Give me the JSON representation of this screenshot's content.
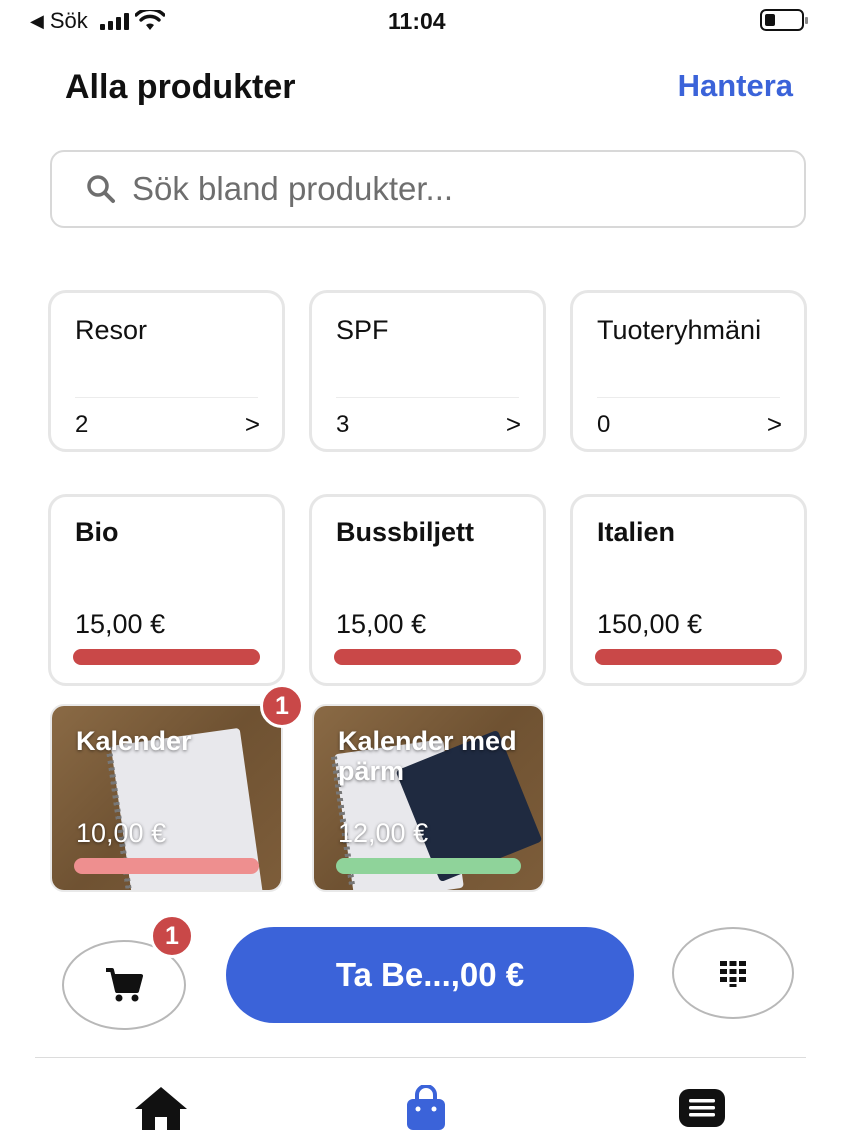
{
  "status_bar": {
    "back_label": "Sök",
    "time": "11:04"
  },
  "header": {
    "title": "Alla produkter",
    "manage_label": "Hantera",
    "accent_color": "#3b63d9"
  },
  "search": {
    "placeholder": "Sök bland produkter..."
  },
  "categories": [
    {
      "name": "Resor",
      "count": "2",
      "chevron": ">"
    },
    {
      "name": "SPF",
      "count": "3",
      "chevron": ">"
    },
    {
      "name": "Tuoteryhmäni",
      "count": "0",
      "chevron": ">"
    }
  ],
  "products": [
    {
      "name": "Bio",
      "price": "15,00 €",
      "bar_color": "#c94848"
    },
    {
      "name": "Bussbiljett",
      "price": "15,00 €",
      "bar_color": "#c94848"
    },
    {
      "name": "Italien",
      "price": "150,00 €",
      "bar_color": "#c94848"
    },
    {
      "name": "Kalender",
      "price": "10,00 €",
      "bar_color": "#ee8f8f",
      "badge": "1",
      "image": "notebook"
    },
    {
      "name": "Kalender med pärm",
      "price": "12,00 €",
      "bar_color": "#8fd39a",
      "image": "notebook-with-binder"
    }
  ],
  "actions": {
    "cart_icon": "cart-icon",
    "cart_badge": "1",
    "charge_label": "Ta Be...,00 €",
    "keypad_icon": "keypad-icon"
  },
  "tab_bar": [
    {
      "icon": "home-icon",
      "active": false
    },
    {
      "icon": "shopping-bag-icon",
      "active": true
    },
    {
      "icon": "list-icon",
      "active": false
    }
  ]
}
